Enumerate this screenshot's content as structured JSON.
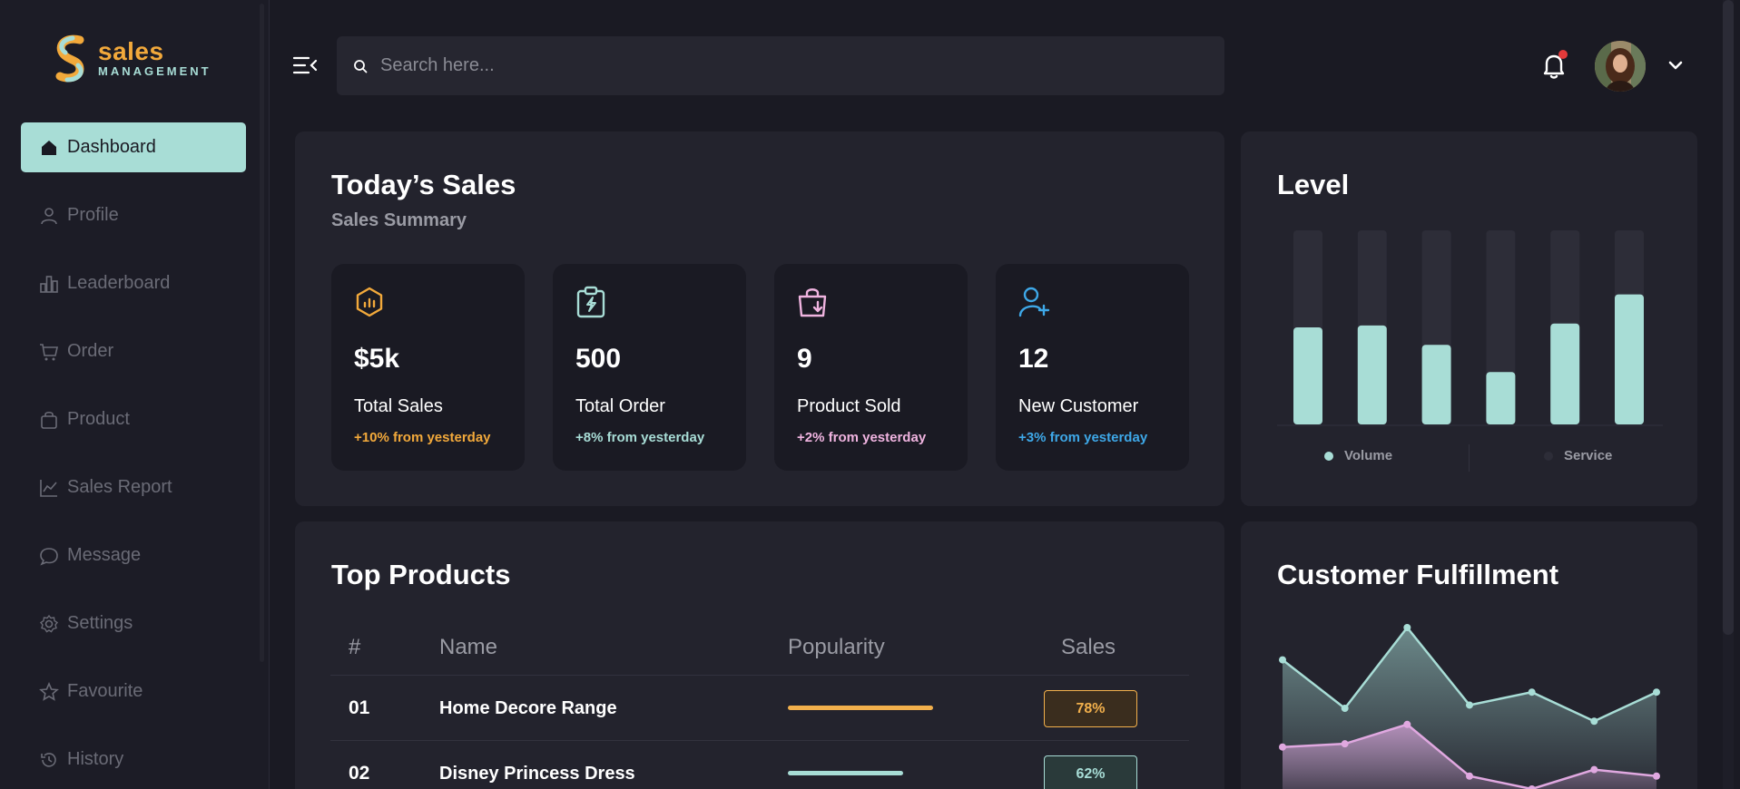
{
  "brand": {
    "name": "sales",
    "sub": "MANAGEMENT"
  },
  "nav": [
    {
      "label": "Dashboard",
      "icon": "home-icon",
      "active": true
    },
    {
      "label": "Profile",
      "icon": "user-icon"
    },
    {
      "label": "Leaderboard",
      "icon": "bar-chart-icon"
    },
    {
      "label": "Order",
      "icon": "cart-icon"
    },
    {
      "label": "Product",
      "icon": "bag-icon"
    },
    {
      "label": "Sales Report",
      "icon": "line-chart-icon"
    },
    {
      "label": "Message",
      "icon": "chat-icon"
    },
    {
      "label": "Settings",
      "icon": "gear-icon"
    },
    {
      "label": "Favourite",
      "icon": "star-icon"
    },
    {
      "label": "History",
      "icon": "history-icon"
    }
  ],
  "search": {
    "placeholder": "Search here..."
  },
  "sales": {
    "title": "Today’s Sales",
    "subtitle": "Sales Summary",
    "stats": [
      {
        "value": "$5k",
        "label": "Total Sales",
        "delta": "+10% from yesterday",
        "color": "#f2a93b"
      },
      {
        "value": "500",
        "label": "Total Order",
        "delta": "+8% from yesterday",
        "color": "#a8ddd6"
      },
      {
        "value": "9",
        "label": "Product Sold",
        "delta": "+2% from yesterday",
        "color": "#f0b4e0"
      },
      {
        "value": "12",
        "label": "New Customer",
        "delta": "+3% from yesterday",
        "color": "#3ea8e8"
      }
    ]
  },
  "level": {
    "title": "Level",
    "legend": [
      "Volume",
      "Service"
    ]
  },
  "products": {
    "title": "Top Products",
    "columns": [
      "#",
      "Name",
      "Popularity",
      "Sales"
    ],
    "rows": [
      {
        "num": "01",
        "name": "Home Decore Range",
        "popularity": 0.78,
        "sales": "78%",
        "color": "#f2b04c",
        "bg": "#3a2d1e"
      },
      {
        "num": "02",
        "name": "Disney Princess Dress",
        "popularity": 0.62,
        "sales": "62%",
        "color": "#a8ddd6",
        "bg": "#2a3a3a"
      }
    ]
  },
  "fulfillment": {
    "title": "Customer Fulfillment"
  },
  "chart_data": [
    {
      "type": "bar",
      "title": "Level",
      "categories": [
        "1",
        "2",
        "3",
        "4",
        "5",
        "6"
      ],
      "series": [
        {
          "name": "Volume",
          "values": [
            50,
            51,
            41,
            27,
            52,
            67
          ]
        },
        {
          "name": "Service",
          "values": [
            50,
            49,
            59,
            73,
            48,
            33
          ]
        }
      ],
      "ylim": [
        0,
        100
      ],
      "stacked": true,
      "legend": "bottom"
    },
    {
      "type": "area",
      "title": "Customer Fulfillment",
      "x": [
        0,
        1,
        2,
        3,
        4,
        5,
        6
      ],
      "series": [
        {
          "values": [
            80,
            50,
            100,
            52,
            60,
            42,
            60
          ]
        },
        {
          "values": [
            26,
            28,
            40,
            8,
            0,
            12,
            8
          ]
        }
      ],
      "ylim": [
        0,
        100
      ]
    }
  ],
  "colors": {
    "accent": "#a8ddd6",
    "bg": "#1a1a23",
    "card": "#23232d"
  }
}
